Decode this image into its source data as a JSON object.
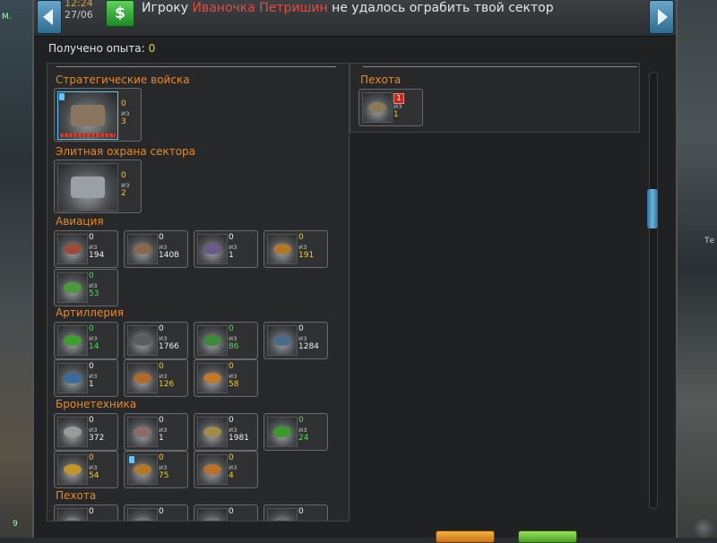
{
  "header": {
    "time": "12:24",
    "date": "27/06",
    "currency_symbol": "$",
    "message_prefix": "Игроку",
    "player_name": "Ивaночка Петришин",
    "message_suffix": "не удалось ограбить твой сектор"
  },
  "experience": {
    "label": "Получено опыта:",
    "value": "0"
  },
  "left_sections": [
    {
      "title": "Стратегические войска",
      "units": [
        {
          "have": "0",
          "of": "из",
          "total": "3"
        }
      ]
    },
    {
      "title": "Элитная охрана сектора",
      "units": [
        {
          "have": "0",
          "of": "из",
          "total": "2"
        }
      ]
    },
    {
      "title": "Авиация",
      "units": [
        {
          "have": "0",
          "of": "из",
          "total": "194"
        },
        {
          "have": "0",
          "of": "из",
          "total": "1408"
        },
        {
          "have": "0",
          "of": "из",
          "total": "1"
        },
        {
          "have": "0",
          "of": "из",
          "total": "191"
        },
        {
          "have": "0",
          "of": "из",
          "total": "53"
        }
      ]
    },
    {
      "title": "Артиллерия",
      "units": [
        {
          "have": "0",
          "of": "из",
          "total": "14"
        },
        {
          "have": "0",
          "of": "из",
          "total": "1766"
        },
        {
          "have": "0",
          "of": "из",
          "total": "86"
        },
        {
          "have": "0",
          "of": "из",
          "total": "1284"
        },
        {
          "have": "0",
          "of": "из",
          "total": "1"
        },
        {
          "have": "0",
          "of": "из",
          "total": "126"
        },
        {
          "have": "0",
          "of": "из",
          "total": "58"
        }
      ]
    },
    {
      "title": "Бронетехника",
      "units": [
        {
          "have": "0",
          "of": "из",
          "total": "372"
        },
        {
          "have": "0",
          "of": "из",
          "total": "1"
        },
        {
          "have": "0",
          "of": "из",
          "total": "1981"
        },
        {
          "have": "0",
          "of": "из",
          "total": "24"
        },
        {
          "have": "0",
          "of": "из",
          "total": "54"
        },
        {
          "have": "0",
          "of": "из",
          "total": "75"
        },
        {
          "have": "0",
          "of": "из",
          "total": "4"
        }
      ]
    },
    {
      "title": "Пехота",
      "units": [
        {
          "have": "0"
        },
        {
          "have": "0"
        },
        {
          "have": "0"
        },
        {
          "have": "0"
        }
      ]
    }
  ],
  "right_sections": [
    {
      "title": "Пехота",
      "units": [
        {
          "level": "1",
          "have": "0",
          "of": "из",
          "total": "1"
        }
      ]
    }
  ],
  "side_marks": {
    "left_top": "M.",
    "left_bottom": "9",
    "right_mid": "Те"
  },
  "colors": {
    "accent_orange": "#ee8823",
    "player_red": "#e84a3c",
    "value_yellow": "#f2cd27",
    "value_green": "#5ed65c"
  }
}
